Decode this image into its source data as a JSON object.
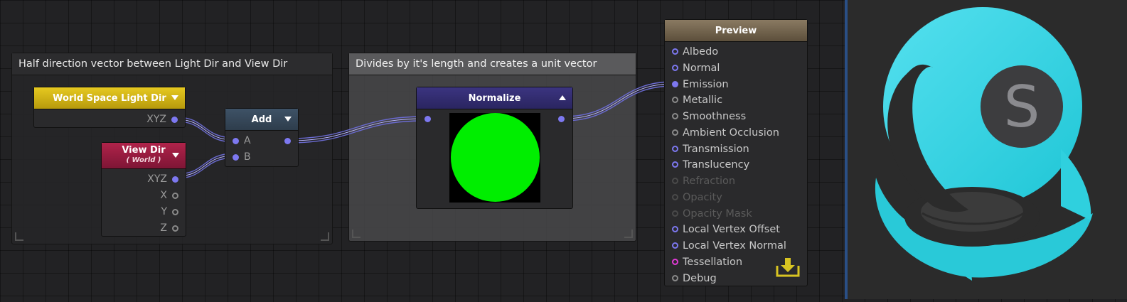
{
  "comments": [
    {
      "title": "Half direction vector between Light Dir and View Dir"
    },
    {
      "title": "Divides by it's length and creates a unit vector"
    }
  ],
  "nodes": {
    "world_space_light_dir": {
      "title": "World Space Light Dir",
      "outputs": [
        "XYZ"
      ]
    },
    "view_dir": {
      "title": "View Dir",
      "subtitle": "( World )",
      "outputs": [
        "XYZ",
        "X",
        "Y",
        "Z"
      ]
    },
    "add": {
      "title": "Add",
      "inputs": [
        "A",
        "B"
      ]
    },
    "normalize": {
      "title": "Normalize"
    },
    "preview": {
      "title": "Preview",
      "inputs": [
        {
          "label": "Albedo"
        },
        {
          "label": "Normal"
        },
        {
          "label": "Emission"
        },
        {
          "label": "Metallic"
        },
        {
          "label": "Smoothness"
        },
        {
          "label": "Ambient Occlusion"
        },
        {
          "label": "Transmission"
        },
        {
          "label": "Translucency"
        },
        {
          "label": "Refraction"
        },
        {
          "label": "Opacity"
        },
        {
          "label": "Opacity Mask"
        },
        {
          "label": "Local Vertex Offset"
        },
        {
          "label": "Local Vertex Normal"
        },
        {
          "label": "Tessellation"
        },
        {
          "label": "Debug"
        }
      ]
    }
  },
  "colors": {
    "wire": "#7d78f0",
    "preview_sphere": "#00ee00",
    "logo_cyan": "#3fd6e4",
    "divider": "#2a4f86"
  },
  "icons": {
    "save": "download-save-icon",
    "logo": "amplify-logo"
  }
}
